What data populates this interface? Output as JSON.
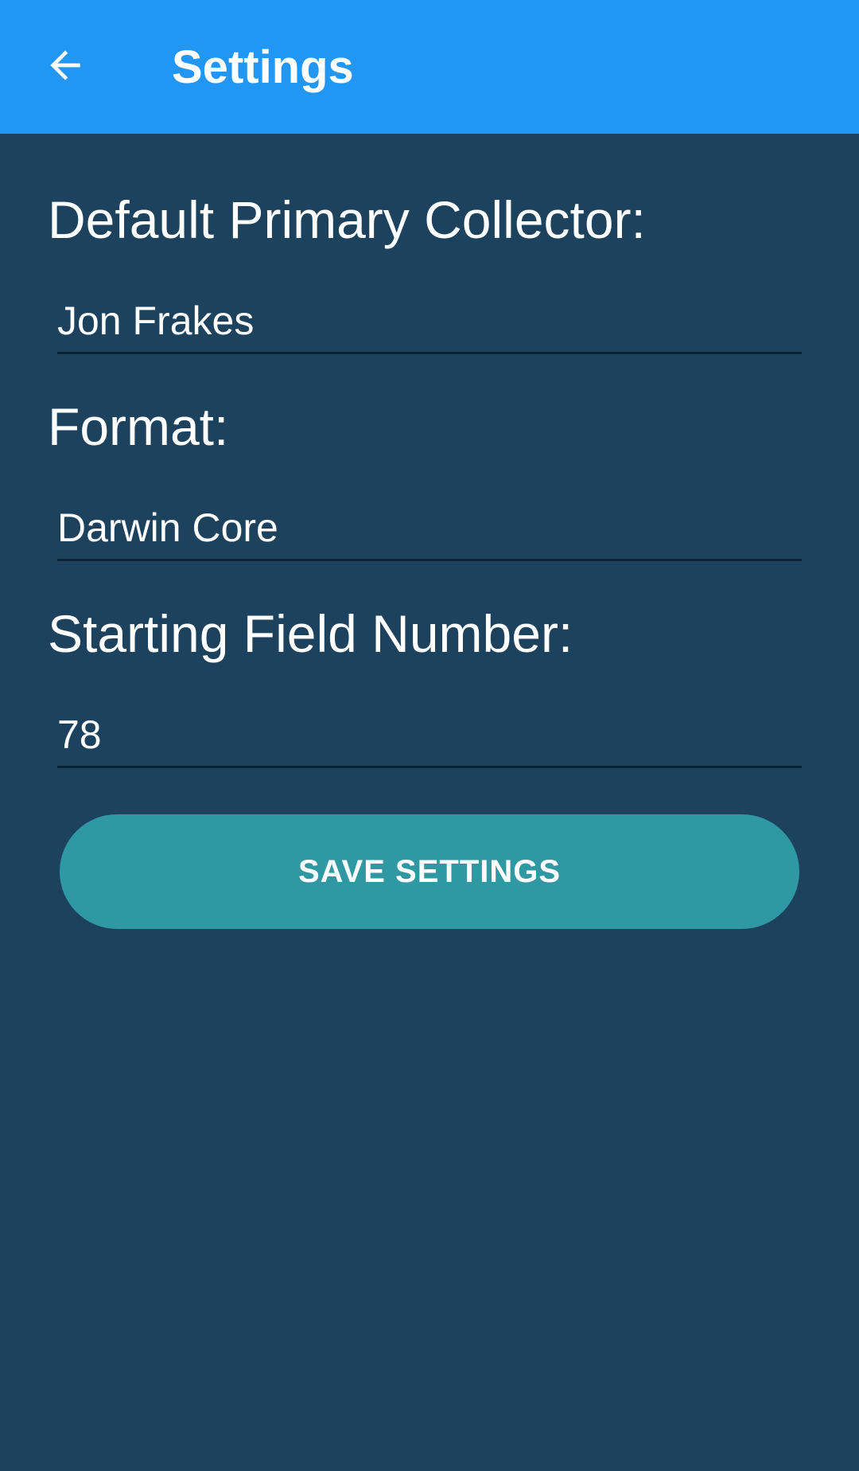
{
  "app_bar": {
    "title": "Settings",
    "back_icon": "arrow-back-icon",
    "color": "#2196f3"
  },
  "form": {
    "collector": {
      "label": "Default Primary Collector:",
      "value": "Jon Frakes"
    },
    "format": {
      "label": "Format:",
      "value": "Darwin Core"
    },
    "field_number": {
      "label": "Starting Field Number:",
      "value": "78"
    }
  },
  "save_button": {
    "label": "SAVE SETTINGS",
    "color": "#3098a2"
  },
  "theme": {
    "background": "#1c425e",
    "text": "#ffffff"
  }
}
